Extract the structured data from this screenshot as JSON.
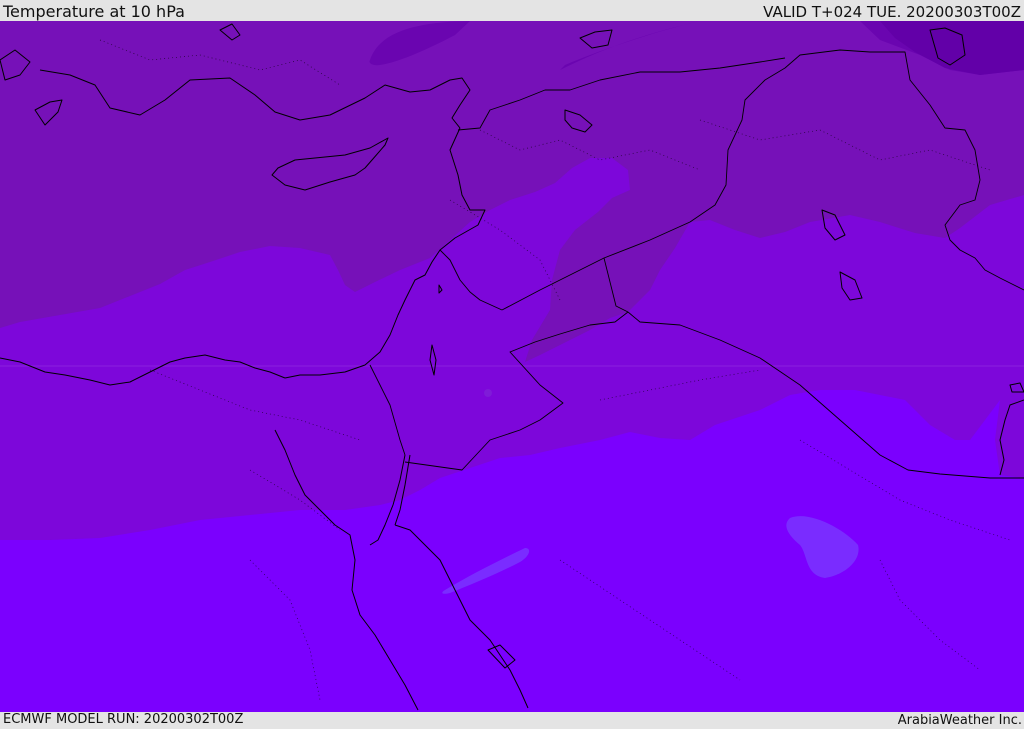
{
  "header": {
    "title": "Temperature at 10 hPa",
    "valid_time": "VALID T+024 TUE. 20200303T00Z"
  },
  "footer": {
    "model_run": "ECMWF MODEL RUN: 20200302T00Z",
    "credit": "ArabiaWeather Inc."
  },
  "colors": {
    "band_coldest": "#6200a8",
    "band_cold": "#7611b8",
    "band_mid": "#7d07da",
    "band_warm": "#7b00fe",
    "spot_warmest": "#7a2cff",
    "coastline": "#000000"
  }
}
